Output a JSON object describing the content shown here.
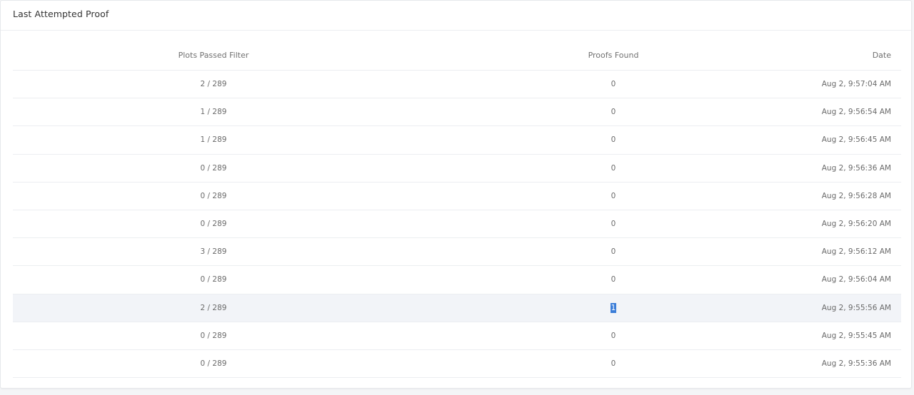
{
  "card": {
    "title": "Last Attempted Proof"
  },
  "table": {
    "headers": [
      "Plots Passed Filter",
      "Proofs Found",
      "Date"
    ],
    "rows": [
      {
        "plots": "2 / 289",
        "proofs": "0",
        "date": "Aug 2, 9:57:04 AM"
      },
      {
        "plots": "1 / 289",
        "proofs": "0",
        "date": "Aug 2, 9:56:54 AM"
      },
      {
        "plots": "1 / 289",
        "proofs": "0",
        "date": "Aug 2, 9:56:45 AM"
      },
      {
        "plots": "0 / 289",
        "proofs": "0",
        "date": "Aug 2, 9:56:36 AM"
      },
      {
        "plots": "0 / 289",
        "proofs": "0",
        "date": "Aug 2, 9:56:28 AM"
      },
      {
        "plots": "0 / 289",
        "proofs": "0",
        "date": "Aug 2, 9:56:20 AM"
      },
      {
        "plots": "3 / 289",
        "proofs": "0",
        "date": "Aug 2, 9:56:12 AM"
      },
      {
        "plots": "0 / 289",
        "proofs": "0",
        "date": "Aug 2, 9:56:04 AM"
      },
      {
        "plots": "2 / 289",
        "proofs": "1",
        "date": "Aug 2, 9:55:56 AM"
      },
      {
        "plots": "0 / 289",
        "proofs": "0",
        "date": "Aug 2, 9:55:45 AM"
      },
      {
        "plots": "0 / 289",
        "proofs": "0",
        "date": "Aug 2, 9:55:36 AM"
      }
    ]
  },
  "colors": {
    "highlight_row": "#f2f4f8",
    "selection": "#3b7dd8"
  }
}
